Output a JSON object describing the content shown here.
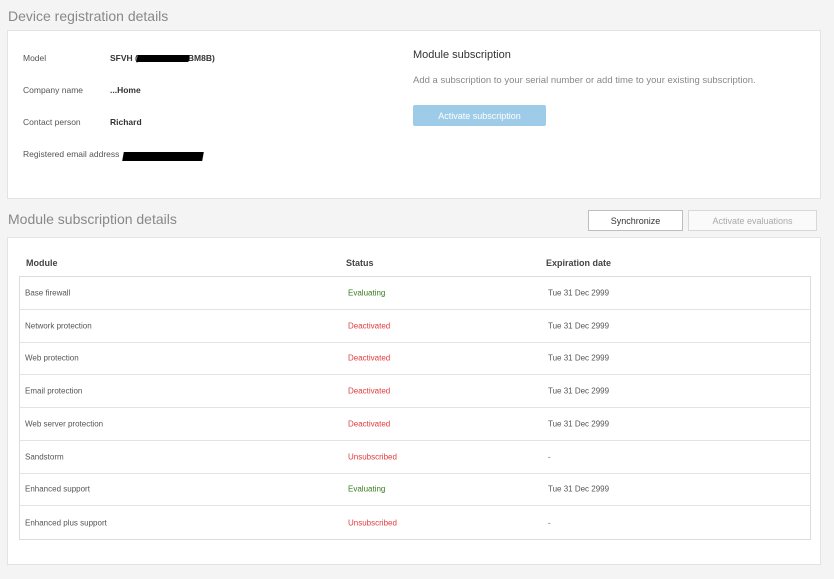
{
  "device_section": {
    "title": "Device registration details",
    "fields": [
      {
        "label": "Model",
        "value_prefix": "SFVH (",
        "value_suffix": "BM8B)"
      },
      {
        "label": "Company name",
        "value": "...Home"
      },
      {
        "label": "Contact person",
        "value": "Richard"
      },
      {
        "label": "Registered email address",
        "value": ""
      }
    ],
    "module_subscription": {
      "title": "Module subscription",
      "description": "Add a subscription to your serial number or add time to your existing subscription.",
      "activate_label": "Activate subscription"
    }
  },
  "modules_section": {
    "title": "Module subscription details",
    "synchronize_label": "Synchronize",
    "activate_evaluations_label": "Activate evaluations",
    "columns": [
      "Module",
      "Status",
      "Expiration date"
    ],
    "rows": [
      {
        "module": "Base firewall",
        "status": "Evaluating",
        "expiration": "Tue 31 Dec 2999"
      },
      {
        "module": "Network protection",
        "status": "Deactivated",
        "expiration": "Tue 31 Dec 2999"
      },
      {
        "module": "Web protection",
        "status": "Deactivated",
        "expiration": "Tue 31 Dec 2999"
      },
      {
        "module": "Email protection",
        "status": "Deactivated",
        "expiration": "Tue 31 Dec 2999"
      },
      {
        "module": "Web server protection",
        "status": "Deactivated",
        "expiration": "Tue 31 Dec 2999"
      },
      {
        "module": "Sandstorm",
        "status": "Unsubscribed",
        "expiration": "-"
      },
      {
        "module": "Enhanced support",
        "status": "Evaluating",
        "expiration": "Tue 31 Dec 2999"
      },
      {
        "module": "Enhanced plus support",
        "status": "Unsubscribed",
        "expiration": "-"
      }
    ]
  },
  "colors": {
    "evaluating": "#3a7d1e",
    "deactivated": "#e23b3b",
    "unsubscribed": "#e23b3b",
    "accent_button": "#9ecbe8"
  }
}
